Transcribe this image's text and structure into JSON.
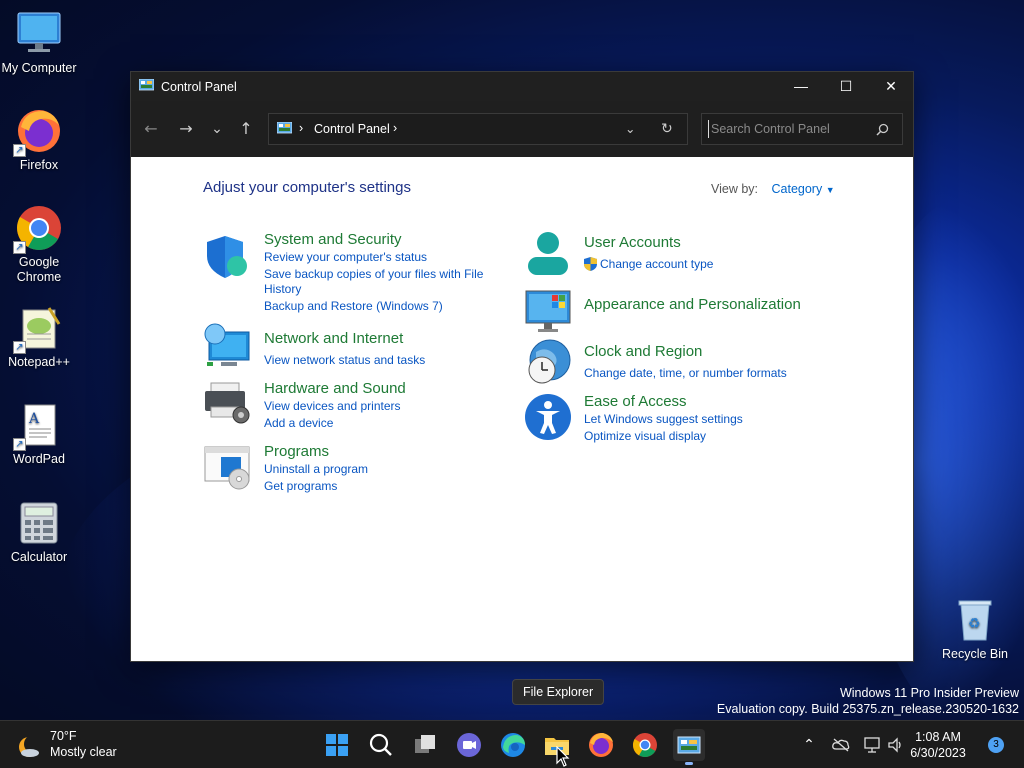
{
  "desktop": {
    "icons": [
      {
        "label": "My Computer"
      },
      {
        "label": "Firefox"
      },
      {
        "label": "Google Chrome"
      },
      {
        "label": "Notepad++"
      },
      {
        "label": "WordPad"
      },
      {
        "label": "Calculator"
      },
      {
        "label": "Recycle Bin"
      }
    ]
  },
  "window": {
    "title": "Control Panel",
    "controls": {
      "minimize": "—",
      "maximize": "☐",
      "close": "✕"
    },
    "nav": {
      "back": "←",
      "forward": "→",
      "recent": "⌄",
      "up": "↑"
    },
    "address": {
      "separator": "›",
      "crumb": "Control Panel",
      "trailing": "›"
    },
    "search": {
      "placeholder": "Search Control Panel"
    }
  },
  "content": {
    "heading": "Adjust your computer's settings",
    "view_by_label": "View by:",
    "view_by_value": "Category",
    "categories": [
      {
        "title": "System and Security",
        "links": [
          "Review your computer's status",
          "Save backup copies of your files with File",
          "History",
          "Backup and Restore (Windows 7)"
        ]
      },
      {
        "title": "Network and Internet",
        "links": [
          "View network status and tasks"
        ]
      },
      {
        "title": "Hardware and Sound",
        "links": [
          "View devices and printers",
          "Add a device"
        ]
      },
      {
        "title": "Programs",
        "links": [
          "Uninstall a program",
          "Get programs"
        ]
      },
      {
        "title": "User Accounts",
        "links": [
          "Change account type"
        ]
      },
      {
        "title": "Appearance and Personalization",
        "links": []
      },
      {
        "title": "Clock and Region",
        "links": [
          "Change date, time, or number formats"
        ]
      },
      {
        "title": "Ease of Access",
        "links": [
          "Let Windows suggest settings",
          "Optimize visual display"
        ]
      }
    ]
  },
  "tooltip": "File Explorer",
  "watermark": {
    "line1": "Windows 11 Pro Insider Preview",
    "line2": "Evaluation copy. Build 25375.zn_release.230520-1632"
  },
  "taskbar": {
    "weather": {
      "temp": "70°F",
      "condition": "Mostly clear"
    },
    "clock": {
      "time": "1:08 AM",
      "date": "6/30/2023"
    },
    "notifications": "3"
  },
  "colors": {
    "category_title": "#1e7a35",
    "link": "#0a56c2",
    "heading": "#1e3287",
    "titlebar": "#202020"
  }
}
